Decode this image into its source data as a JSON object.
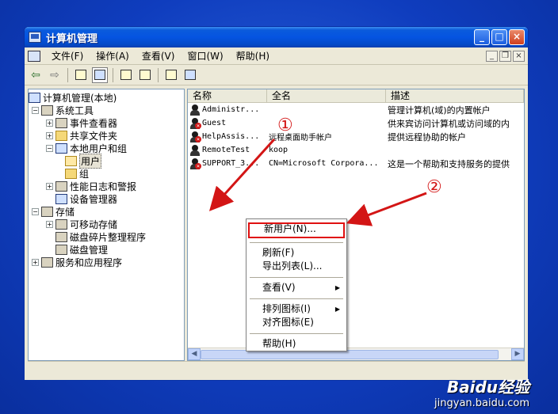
{
  "window": {
    "title": "计算机管理",
    "controls": {
      "minimize": "_",
      "maximize": "□",
      "close": "×"
    }
  },
  "menu": {
    "items": [
      "文件(F)",
      "操作(A)",
      "查看(V)",
      "窗口(W)",
      "帮助(H)"
    ],
    "mdi_controls": {
      "minimize": "_",
      "restore": "❐",
      "close": "×"
    }
  },
  "tree": {
    "root": "计算机管理(本地)",
    "system_tools": "系统工具",
    "event_viewer": "事件查看器",
    "shared_folders": "共享文件夹",
    "local_users_groups": "本地用户和组",
    "users": "用户",
    "groups": "组",
    "perf_logs": "性能日志和警报",
    "device_manager": "设备管理器",
    "storage": "存储",
    "removable_storage": "可移动存储",
    "defrag": "磁盘碎片整理程序",
    "disk_mgmt": "磁盘管理",
    "services_apps": "服务和应用程序"
  },
  "list": {
    "headers": [
      "名称",
      "全名",
      "描述"
    ],
    "rows": [
      {
        "name": "Administr...",
        "full": "",
        "desc": "管理计算机(域)的内置帐户",
        "disabled": false
      },
      {
        "name": "Guest",
        "full": "",
        "desc": "供来宾访问计算机或访问域的内",
        "disabled": true
      },
      {
        "name": "HelpAssis...",
        "full": "远程桌面助手帐户",
        "desc": "提供远程协助的帐户",
        "disabled": true
      },
      {
        "name": "RemoteTest",
        "full": "koop",
        "desc": "",
        "disabled": false
      },
      {
        "name": "SUPPORT_3...",
        "full": "CN=Microsoft Corpora...",
        "desc": "这是一个帮助和支持服务的提供",
        "disabled": true
      }
    ]
  },
  "context_menu": {
    "new_user": "新用户(N)...",
    "refresh": "刷新(F)",
    "export_list": "导出列表(L)...",
    "view": "查看(V)",
    "arrange_icons": "排列图标(I)",
    "line_up_icons": "对齐图标(E)",
    "help": "帮助(H)"
  },
  "annotations": {
    "callout_1": "①",
    "callout_2": "②"
  },
  "watermark": {
    "brand": "Baidu经验",
    "url": "jingyan.baidu.com"
  },
  "colors": {
    "desktop": "#0a3cbe",
    "highlight": "#e01010",
    "titlebar": "#0554e1"
  }
}
